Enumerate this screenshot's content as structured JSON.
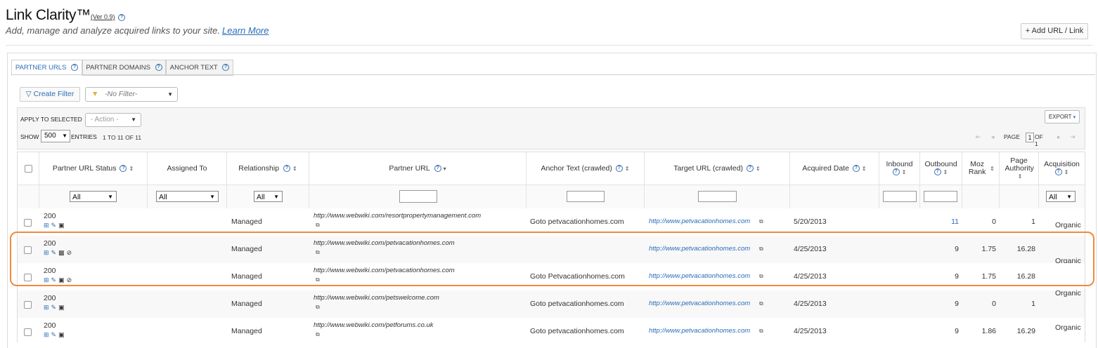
{
  "header": {
    "title": "Link Clarity™",
    "version": "(Ver 0.9)",
    "subtitle": "Add, manage and analyze acquired links to your site.",
    "learn_more": "Learn More",
    "add_button": "+ Add URL / Link"
  },
  "tabs": [
    {
      "label": "PARTNER URLS"
    },
    {
      "label": "PARTNER DOMAINS"
    },
    {
      "label": "ANCHOR TEXT"
    }
  ],
  "filters": {
    "create_filter": "Create Filter",
    "no_filter": "-No Filter-"
  },
  "toolbar": {
    "apply_label": "APPLY TO SELECTED",
    "action_placeholder": "- Action -",
    "show_label": "SHOW",
    "show_value": "500",
    "entries_label": "ENTRIES",
    "range": "1 TO 11 OF 11",
    "export": "EXPORT",
    "page_label": "PAGE",
    "page_value": "1",
    "of_label": "OF 1"
  },
  "columns": [
    {
      "label": "Partner URL Status"
    },
    {
      "label": "Assigned To"
    },
    {
      "label": "Relationship"
    },
    {
      "label": "Partner URL"
    },
    {
      "label": "Anchor Text (crawled)"
    },
    {
      "label": "Target URL (crawled)"
    },
    {
      "label": "Acquired Date"
    },
    {
      "label": "Inbound"
    },
    {
      "label": "Outbound"
    },
    {
      "label": "Moz Rank"
    },
    {
      "label": "Page Authority"
    },
    {
      "label": "Acquisition"
    }
  ],
  "column_filters": {
    "status": "All",
    "assigned": "All",
    "relationship": "All",
    "acquisition": "All"
  },
  "rows": [
    {
      "status": "200",
      "relationship": "Managed",
      "partner_url": "http://www.webwiki.com/resortpropertymanagement.com",
      "anchor": "Goto petvacationhomes.com",
      "target": "http://www.petvacationhomes.com",
      "date": "5/20/2013",
      "outbound": "11",
      "moz": "0",
      "pa": "1",
      "acquisition": "Organic"
    },
    {
      "status": "200",
      "relationship": "Managed",
      "partner_url": "http://www.webwiki.com/petvacationhomes.com",
      "anchor": "",
      "target": "http://www.petvacationhomes.com",
      "date": "4/25/2013",
      "outbound": "9",
      "moz": "1.75",
      "pa": "16.28",
      "acquisition": "Organic"
    },
    {
      "status": "200",
      "relationship": "Managed",
      "partner_url": "http://www.webwiki.com/petvacationhomes.com",
      "anchor": "Goto Petvacationhomes.com",
      "target": "http://www.petvacationhomes.com",
      "date": "4/25/2013",
      "outbound": "9",
      "moz": "1.75",
      "pa": "16.28",
      "acquisition": ""
    },
    {
      "status": "200",
      "relationship": "Managed",
      "partner_url": "http://www.webwiki.com/petswelcome.com",
      "anchor": "Goto petvacationhomes.com",
      "target": "http://www.petvacationhomes.com",
      "date": "4/25/2013",
      "outbound": "9",
      "moz": "0",
      "pa": "1",
      "acquisition": "Organic"
    },
    {
      "status": "200",
      "relationship": "Managed",
      "partner_url": "http://www.webwiki.com/petforums.co.uk",
      "anchor": "Goto petvacationhomes.com",
      "target": "http://www.petvacationhomes.com",
      "date": "4/25/2013",
      "outbound": "9",
      "moz": "1.86",
      "pa": "16.29",
      "acquisition": "Organic"
    }
  ],
  "colors": {
    "accent": "#2a6cb8",
    "highlight": "#f08a3c"
  }
}
